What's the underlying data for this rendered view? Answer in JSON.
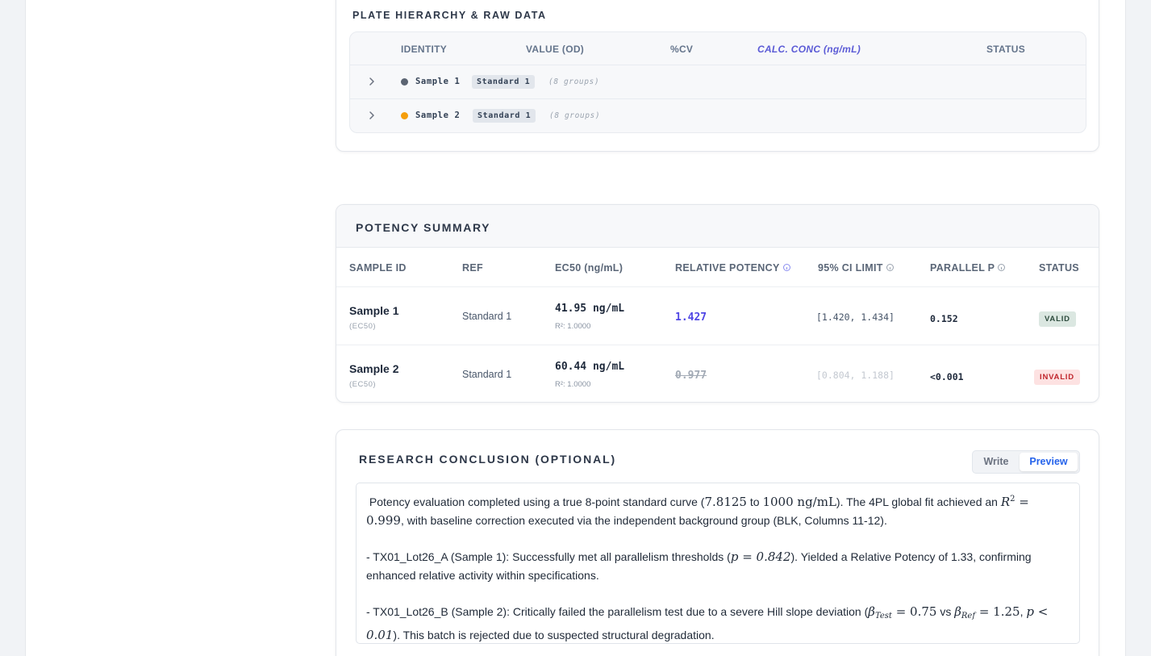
{
  "plate": {
    "title": "PLATE HIERARCHY & RAW DATA",
    "columns": {
      "identity": "IDENTITY",
      "value": "VALUE (OD)",
      "cv": "%CV",
      "calc": "CALC. CONC (ng/mL)",
      "status": "STATUS"
    },
    "rows": [
      {
        "sample": "Sample 1",
        "reference": "Standard 1",
        "groups": "(8 groups)",
        "color": "#5b6472"
      },
      {
        "sample": "Sample 2",
        "reference": "Standard 1",
        "groups": "(8 groups)",
        "color": "#f59e0b"
      }
    ]
  },
  "potency": {
    "title": "POTENCY SUMMARY",
    "columns": {
      "sample_id": "SAMPLE ID",
      "ref": "REF",
      "ec50": "EC50 (ng/mL)",
      "relative_potency": "RELATIVE POTENCY",
      "ci": "95% CI LIMIT",
      "parallel": "PARALLEL P",
      "status": "STATUS"
    },
    "rows": [
      {
        "sample": "Sample 1",
        "sub": "(EC50)",
        "ref": "Standard 1",
        "ec50": "41.95 ng/mL",
        "r2": "R²: 1.0000",
        "rp": "1.427",
        "ci": "[1.420, 1.434]",
        "parallel_p": "0.152",
        "status": "VALID"
      },
      {
        "sample": "Sample 2",
        "sub": "(EC50)",
        "ref": "Standard 1",
        "ec50": "60.44 ng/mL",
        "r2": "R²: 1.0000",
        "rp": "0.977",
        "ci": "[0.804, 1.188]",
        "parallel_p": "<0.001",
        "status": "INVALID"
      }
    ]
  },
  "conclusion": {
    "title": "RESEARCH CONCLUSION (OPTIONAL)",
    "tabs": {
      "write": "Write",
      "preview": "Preview"
    },
    "p1": {
      "a": "Potency evaluation completed using a true 8-point standard curve (",
      "m1": "7.8125",
      "to": " to ",
      "m2": "1000",
      "unit": "ng/mL",
      "b": "). The 4PL global fit achieved an ",
      "m3": "R",
      "m3sup": "2",
      "m3eq": " = 0.999",
      "c": ", with baseline correction executed via the independent background group (BLK, Columns 11-12)."
    },
    "p2": {
      "a": "- TX01_Lot26_A (Sample 1): Successfully met all parallelism thresholds (",
      "m": "p = 0.842",
      "b": "). Yielded a Relative Potency of 1.33, confirming enhanced relative activity within specifications."
    },
    "p3": {
      "a": "- TX01_Lot26_B (Sample 2): Critically failed the parallelism test due to a severe Hill slope deviation (",
      "m1": "β",
      "m1sub": "Test",
      "m1eq": " = 0.75",
      "vs": " vs ",
      "m2": "β",
      "m2sub": "Ref",
      "m2eq": " = 1.25",
      "comma": ", ",
      "m3": "p < 0.01",
      "b": "). This batch is rejected due to suspected structural degradation."
    }
  }
}
